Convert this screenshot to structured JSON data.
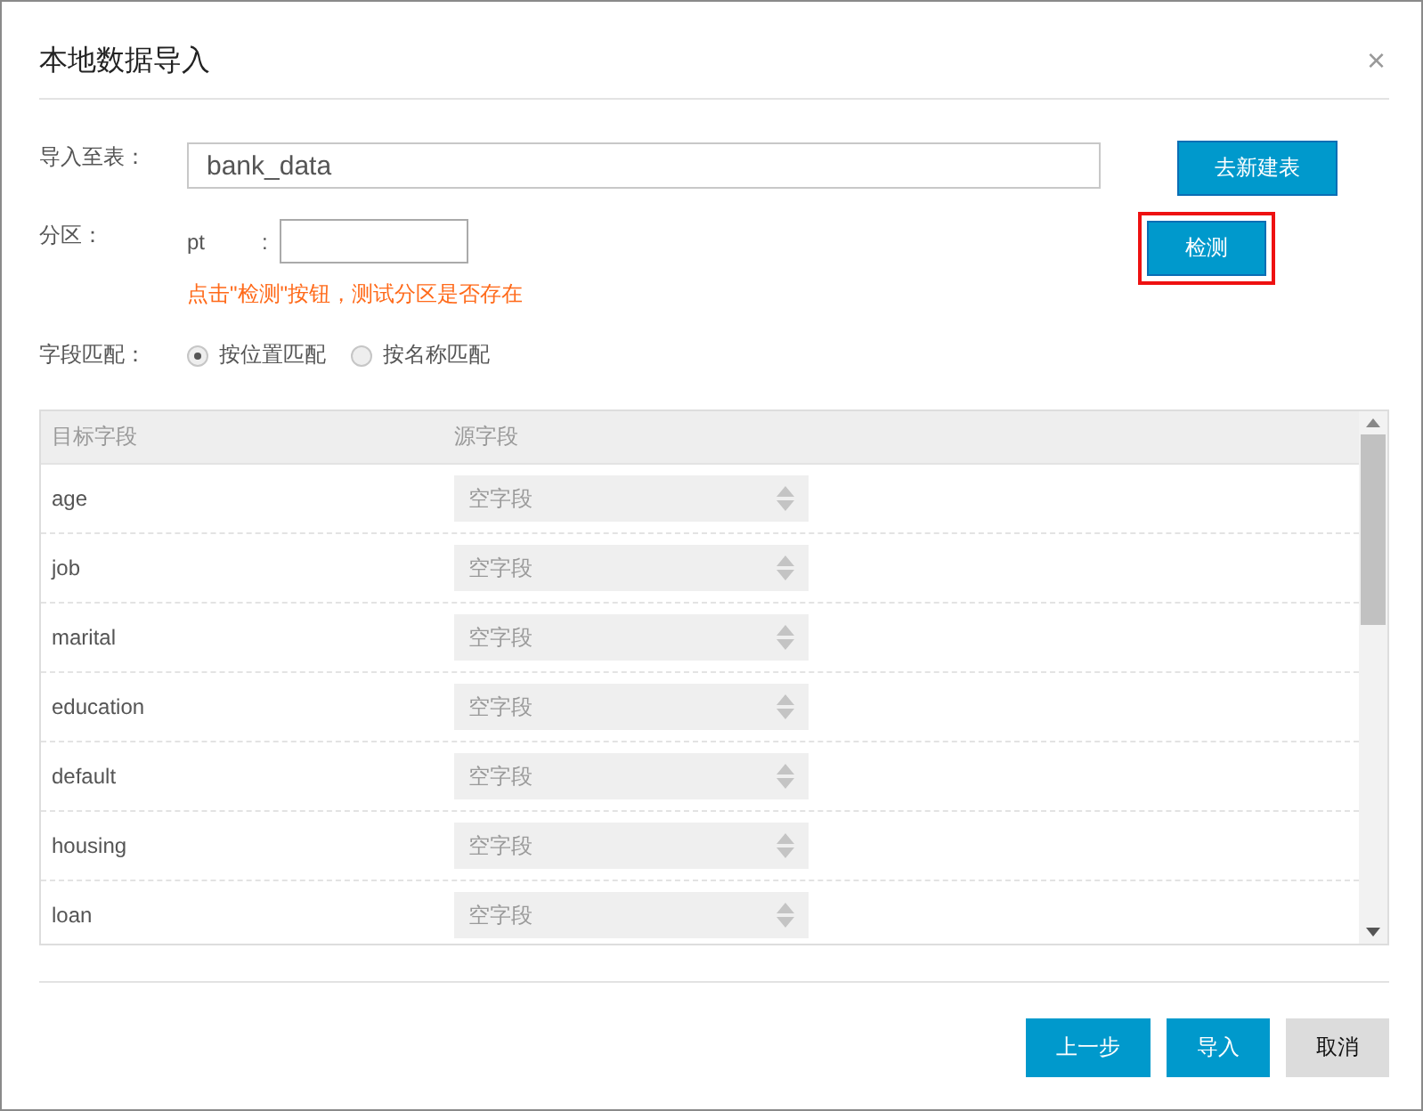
{
  "dialog": {
    "title": "本地数据导入",
    "close": "×"
  },
  "target_table": {
    "label": "导入至表：",
    "value": "bank_data",
    "button": "去新建表"
  },
  "partition": {
    "label": "分区：",
    "key": "pt",
    "separator": ":",
    "button": "检测",
    "highlighted": true,
    "hint": "点击\"检测\"按钮，测试分区是否存在"
  },
  "field_match": {
    "label": "字段匹配：",
    "options": [
      {
        "label": "按位置匹配",
        "selected": true
      },
      {
        "label": "按名称匹配",
        "selected": false
      }
    ]
  },
  "table": {
    "columns": [
      "目标字段",
      "源字段"
    ],
    "rows": [
      {
        "target": "age",
        "source": "空字段",
        "disabled": true
      },
      {
        "target": "job",
        "source": "空字段",
        "disabled": true
      },
      {
        "target": "marital",
        "source": "空字段",
        "disabled": true
      },
      {
        "target": "education",
        "source": "空字段",
        "disabled": true
      },
      {
        "target": "default",
        "source": "空字段",
        "disabled": true
      },
      {
        "target": "housing",
        "source": "空字段",
        "disabled": true
      },
      {
        "target": "loan",
        "source": "空字段",
        "disabled": true
      }
    ]
  },
  "buttons": [
    {
      "label": "上一步",
      "kind": "primary"
    },
    {
      "label": "导入",
      "kind": "primary"
    },
    {
      "label": "取消",
      "kind": "secondary"
    }
  ]
}
